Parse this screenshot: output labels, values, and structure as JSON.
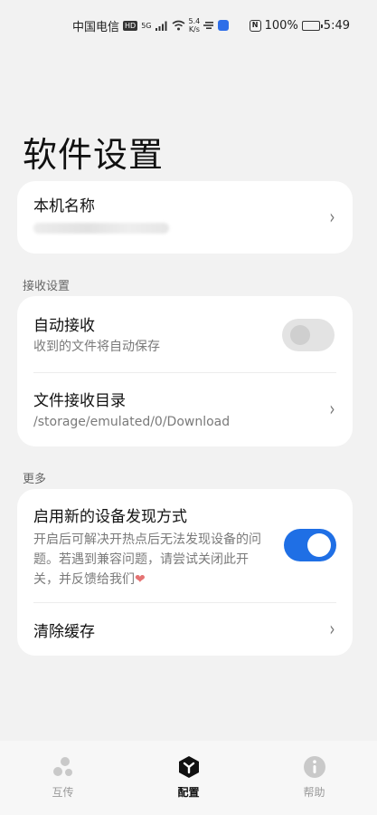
{
  "status_bar": {
    "carrier": "中国电信",
    "hd_badge": "HD",
    "signal_label": "5G",
    "net_speed_value": "5.4",
    "net_speed_unit": "K/s",
    "nfc_label": "N",
    "battery": "100%",
    "time": "5:49"
  },
  "page": {
    "title": "软件设置"
  },
  "device_card": {
    "title": "本机名称"
  },
  "receive_section": {
    "label": "接收设置",
    "auto_receive": {
      "title": "自动接收",
      "subtitle": "收到的文件将自动保存",
      "enabled": false
    },
    "receive_dir": {
      "title": "文件接收目录",
      "subtitle": "/storage/emulated/0/Download"
    }
  },
  "more_section": {
    "label": "更多",
    "new_discovery": {
      "title": "启用新的设备发现方式",
      "subtitle": "开启后可解决开热点后无法发现设备的问题。若遇到兼容问题，请尝试关闭此开关，并反馈给我们",
      "heart": "❤",
      "enabled": true
    },
    "clear_cache": {
      "title": "清除缓存"
    }
  },
  "chevron": "›",
  "bottom_nav": [
    {
      "label": "互传",
      "icon": "transfer-icon",
      "active": false
    },
    {
      "label": "配置",
      "icon": "config-icon",
      "active": true
    },
    {
      "label": "帮助",
      "icon": "info-icon",
      "active": false
    }
  ],
  "colors": {
    "accent": "#1f6fe5",
    "background": "#f2f2f2",
    "card": "#ffffff"
  }
}
